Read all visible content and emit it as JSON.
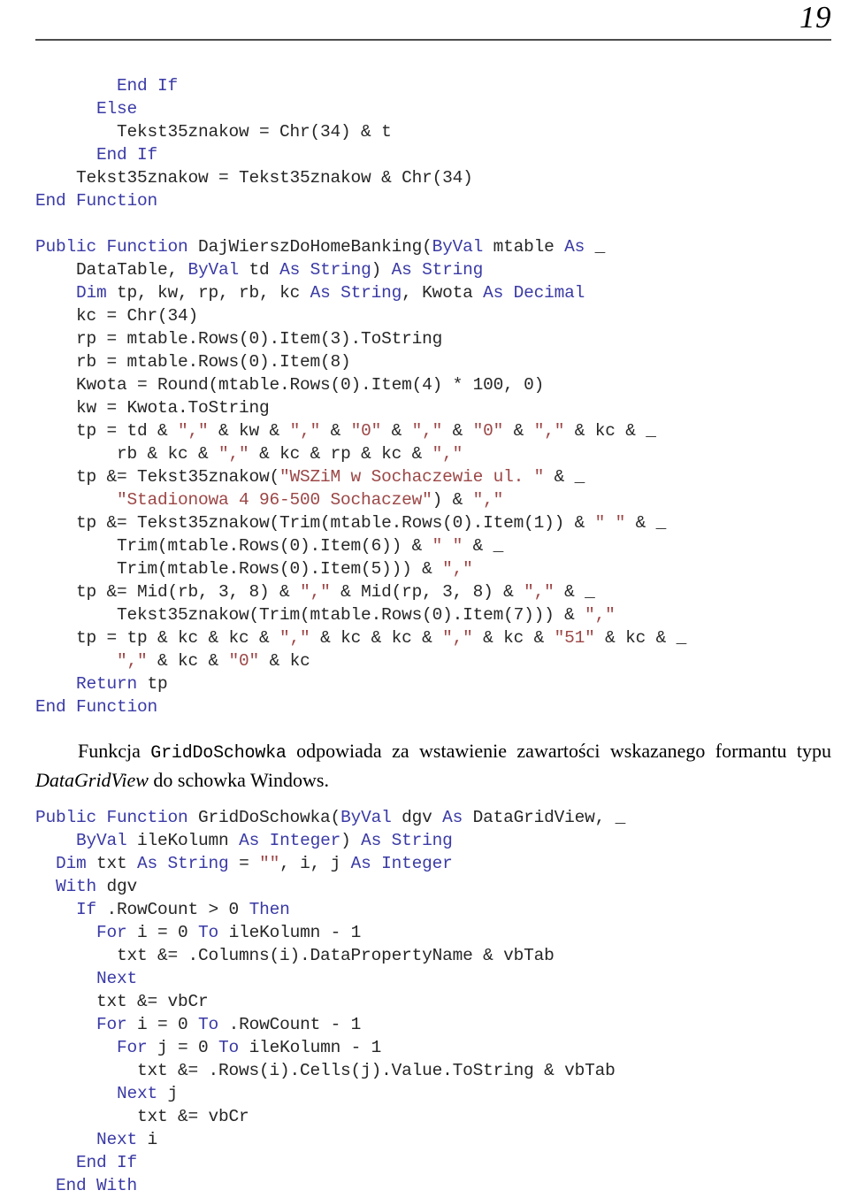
{
  "header": {
    "page_number": "19",
    "rule_color": "#4c4c4c"
  },
  "theme": {
    "keyword_color": "#3a3aa6",
    "string_color": "#9c4646",
    "identifier_color": "#262626",
    "background": "#ffffff"
  },
  "code_block_1": {
    "language": "Visual Basic .NET",
    "lines": [
      [
        {
          "t": "        ",
          "c": "id"
        },
        {
          "t": "End If",
          "c": "k"
        }
      ],
      [
        {
          "t": "      ",
          "c": "id"
        },
        {
          "t": "Else",
          "c": "k"
        }
      ],
      [
        {
          "t": "        Tekst35znakow = Chr(34) & t",
          "c": "id"
        }
      ],
      [
        {
          "t": "      ",
          "c": "id"
        },
        {
          "t": "End If",
          "c": "k"
        }
      ],
      [
        {
          "t": "    Tekst35znakow = Tekst35znakow & Chr(34)",
          "c": "id"
        }
      ],
      [
        {
          "t": "End Function",
          "c": "k"
        }
      ],
      [],
      [
        {
          "t": "Public Function",
          "c": "k"
        },
        {
          "t": " DajWierszDoHomeBanking(",
          "c": "id"
        },
        {
          "t": "ByVal",
          "c": "k"
        },
        {
          "t": " mtable ",
          "c": "id"
        },
        {
          "t": "As",
          "c": "k"
        },
        {
          "t": " _",
          "c": "id"
        }
      ],
      [
        {
          "t": "    DataTable, ",
          "c": "id"
        },
        {
          "t": "ByVal",
          "c": "k"
        },
        {
          "t": " td ",
          "c": "id"
        },
        {
          "t": "As String",
          "c": "k"
        },
        {
          "t": ") ",
          "c": "id"
        },
        {
          "t": "As String",
          "c": "k"
        }
      ],
      [
        {
          "t": "    ",
          "c": "id"
        },
        {
          "t": "Dim",
          "c": "k"
        },
        {
          "t": " tp, kw, rp, rb, kc ",
          "c": "id"
        },
        {
          "t": "As String",
          "c": "k"
        },
        {
          "t": ", Kwota ",
          "c": "id"
        },
        {
          "t": "As Decimal",
          "c": "k"
        }
      ],
      [
        {
          "t": "    kc = Chr(34)",
          "c": "id"
        }
      ],
      [
        {
          "t": "    rp = mtable.Rows(0).Item(3).ToString",
          "c": "id"
        }
      ],
      [
        {
          "t": "    rb = mtable.Rows(0).Item(8)",
          "c": "id"
        }
      ],
      [
        {
          "t": "    Kwota = Round(mtable.Rows(0).Item(4) * 100, 0)",
          "c": "id"
        }
      ],
      [
        {
          "t": "    kw = Kwota.ToString",
          "c": "id"
        }
      ],
      [
        {
          "t": "    tp = td & ",
          "c": "id"
        },
        {
          "t": "\",\"",
          "c": "s"
        },
        {
          "t": " & kw & ",
          "c": "id"
        },
        {
          "t": "\",\"",
          "c": "s"
        },
        {
          "t": " & ",
          "c": "id"
        },
        {
          "t": "\"0\"",
          "c": "s"
        },
        {
          "t": " & ",
          "c": "id"
        },
        {
          "t": "\",\"",
          "c": "s"
        },
        {
          "t": " & ",
          "c": "id"
        },
        {
          "t": "\"0\"",
          "c": "s"
        },
        {
          "t": " & ",
          "c": "id"
        },
        {
          "t": "\",\"",
          "c": "s"
        },
        {
          "t": " & kc & _",
          "c": "id"
        }
      ],
      [
        {
          "t": "        rb & kc & ",
          "c": "id"
        },
        {
          "t": "\",\"",
          "c": "s"
        },
        {
          "t": " & kc & rp & kc & ",
          "c": "id"
        },
        {
          "t": "\",\"",
          "c": "s"
        }
      ],
      [
        {
          "t": "    tp &= Tekst35znakow(",
          "c": "id"
        },
        {
          "t": "\"WSZiM w Sochaczewie ul. \"",
          "c": "s"
        },
        {
          "t": " & _",
          "c": "id"
        }
      ],
      [
        {
          "t": "        ",
          "c": "id"
        },
        {
          "t": "\"Stadionowa 4 96-500 Sochaczew\"",
          "c": "s"
        },
        {
          "t": ") & ",
          "c": "id"
        },
        {
          "t": "\",\"",
          "c": "s"
        }
      ],
      [
        {
          "t": "    tp &= Tekst35znakow(Trim(mtable.Rows(0).Item(1)) & ",
          "c": "id"
        },
        {
          "t": "\" \"",
          "c": "s"
        },
        {
          "t": " & _",
          "c": "id"
        }
      ],
      [
        {
          "t": "        Trim(mtable.Rows(0).Item(6)) & ",
          "c": "id"
        },
        {
          "t": "\" \"",
          "c": "s"
        },
        {
          "t": " & _",
          "c": "id"
        }
      ],
      [
        {
          "t": "        Trim(mtable.Rows(0).Item(5))) & ",
          "c": "id"
        },
        {
          "t": "\",\"",
          "c": "s"
        }
      ],
      [
        {
          "t": "    tp &= Mid(rb, 3, 8) & ",
          "c": "id"
        },
        {
          "t": "\",\"",
          "c": "s"
        },
        {
          "t": " & Mid(rp, 3, 8) & ",
          "c": "id"
        },
        {
          "t": "\",\"",
          "c": "s"
        },
        {
          "t": " & _",
          "c": "id"
        }
      ],
      [
        {
          "t": "        Tekst35znakow(Trim(mtable.Rows(0).Item(7))) & ",
          "c": "id"
        },
        {
          "t": "\",\"",
          "c": "s"
        }
      ],
      [
        {
          "t": "    tp = tp & kc & kc & ",
          "c": "id"
        },
        {
          "t": "\",\"",
          "c": "s"
        },
        {
          "t": " & kc & kc & ",
          "c": "id"
        },
        {
          "t": "\",\"",
          "c": "s"
        },
        {
          "t": " & kc & ",
          "c": "id"
        },
        {
          "t": "\"51\"",
          "c": "s"
        },
        {
          "t": " & kc & _",
          "c": "id"
        }
      ],
      [
        {
          "t": "        ",
          "c": "id"
        },
        {
          "t": "\",\"",
          "c": "s"
        },
        {
          "t": " & kc & ",
          "c": "id"
        },
        {
          "t": "\"0\"",
          "c": "s"
        },
        {
          "t": " & kc",
          "c": "id"
        }
      ],
      [
        {
          "t": "    ",
          "c": "id"
        },
        {
          "t": "Return",
          "c": "k"
        },
        {
          "t": " tp",
          "c": "id"
        }
      ],
      [
        {
          "t": "End Function",
          "c": "k"
        }
      ]
    ]
  },
  "paragraph": {
    "segments": [
      {
        "t": "Funkcja ",
        "style": "serif"
      },
      {
        "t": "GridDoSchowka",
        "style": "mono"
      },
      {
        "t": " odpowiada za wstawienie zawartości wskazanego formantu typu ",
        "style": "serif"
      },
      {
        "t": "DataGridView",
        "style": "italic"
      },
      {
        "t": " do schowka Windows.",
        "style": "serif"
      }
    ]
  },
  "code_block_2": {
    "language": "Visual Basic .NET",
    "lines": [
      [
        {
          "t": "Public Function",
          "c": "k"
        },
        {
          "t": " GridDoSchowka(",
          "c": "id"
        },
        {
          "t": "ByVal",
          "c": "k"
        },
        {
          "t": " dgv ",
          "c": "id"
        },
        {
          "t": "As",
          "c": "k"
        },
        {
          "t": " DataGridView, _",
          "c": "id"
        }
      ],
      [
        {
          "t": "    ",
          "c": "id"
        },
        {
          "t": "ByVal",
          "c": "k"
        },
        {
          "t": " ileKolumn ",
          "c": "id"
        },
        {
          "t": "As Integer",
          "c": "k"
        },
        {
          "t": ") ",
          "c": "id"
        },
        {
          "t": "As String",
          "c": "k"
        }
      ],
      [
        {
          "t": "  ",
          "c": "id"
        },
        {
          "t": "Dim",
          "c": "k"
        },
        {
          "t": " txt ",
          "c": "id"
        },
        {
          "t": "As String",
          "c": "k"
        },
        {
          "t": " = ",
          "c": "id"
        },
        {
          "t": "\"\"",
          "c": "s"
        },
        {
          "t": ", i, j ",
          "c": "id"
        },
        {
          "t": "As Integer",
          "c": "k"
        }
      ],
      [
        {
          "t": "  ",
          "c": "id"
        },
        {
          "t": "With",
          "c": "k"
        },
        {
          "t": " dgv",
          "c": "id"
        }
      ],
      [
        {
          "t": "    ",
          "c": "id"
        },
        {
          "t": "If",
          "c": "k"
        },
        {
          "t": " .RowCount > 0 ",
          "c": "id"
        },
        {
          "t": "Then",
          "c": "k"
        }
      ],
      [
        {
          "t": "      ",
          "c": "id"
        },
        {
          "t": "For",
          "c": "k"
        },
        {
          "t": " i = 0 ",
          "c": "id"
        },
        {
          "t": "To",
          "c": "k"
        },
        {
          "t": " ileKolumn - 1",
          "c": "id"
        }
      ],
      [
        {
          "t": "        txt &= .Columns(i).DataPropertyName & vbTab",
          "c": "id"
        }
      ],
      [
        {
          "t": "      ",
          "c": "id"
        },
        {
          "t": "Next",
          "c": "k"
        }
      ],
      [
        {
          "t": "      txt &= vbCr",
          "c": "id"
        }
      ],
      [
        {
          "t": "      ",
          "c": "id"
        },
        {
          "t": "For",
          "c": "k"
        },
        {
          "t": " i = 0 ",
          "c": "id"
        },
        {
          "t": "To",
          "c": "k"
        },
        {
          "t": " .RowCount - 1",
          "c": "id"
        }
      ],
      [
        {
          "t": "        ",
          "c": "id"
        },
        {
          "t": "For",
          "c": "k"
        },
        {
          "t": " j = 0 ",
          "c": "id"
        },
        {
          "t": "To",
          "c": "k"
        },
        {
          "t": " ileKolumn - 1",
          "c": "id"
        }
      ],
      [
        {
          "t": "          txt &= .Rows(i).Cells(j).Value.ToString & vbTab",
          "c": "id"
        }
      ],
      [
        {
          "t": "        ",
          "c": "id"
        },
        {
          "t": "Next",
          "c": "k"
        },
        {
          "t": " j",
          "c": "id"
        }
      ],
      [
        {
          "t": "          txt &= vbCr",
          "c": "id"
        }
      ],
      [
        {
          "t": "      ",
          "c": "id"
        },
        {
          "t": "Next",
          "c": "k"
        },
        {
          "t": " i",
          "c": "id"
        }
      ],
      [
        {
          "t": "    ",
          "c": "id"
        },
        {
          "t": "End If",
          "c": "k"
        }
      ],
      [
        {
          "t": "  ",
          "c": "id"
        },
        {
          "t": "End With",
          "c": "k"
        }
      ]
    ]
  }
}
